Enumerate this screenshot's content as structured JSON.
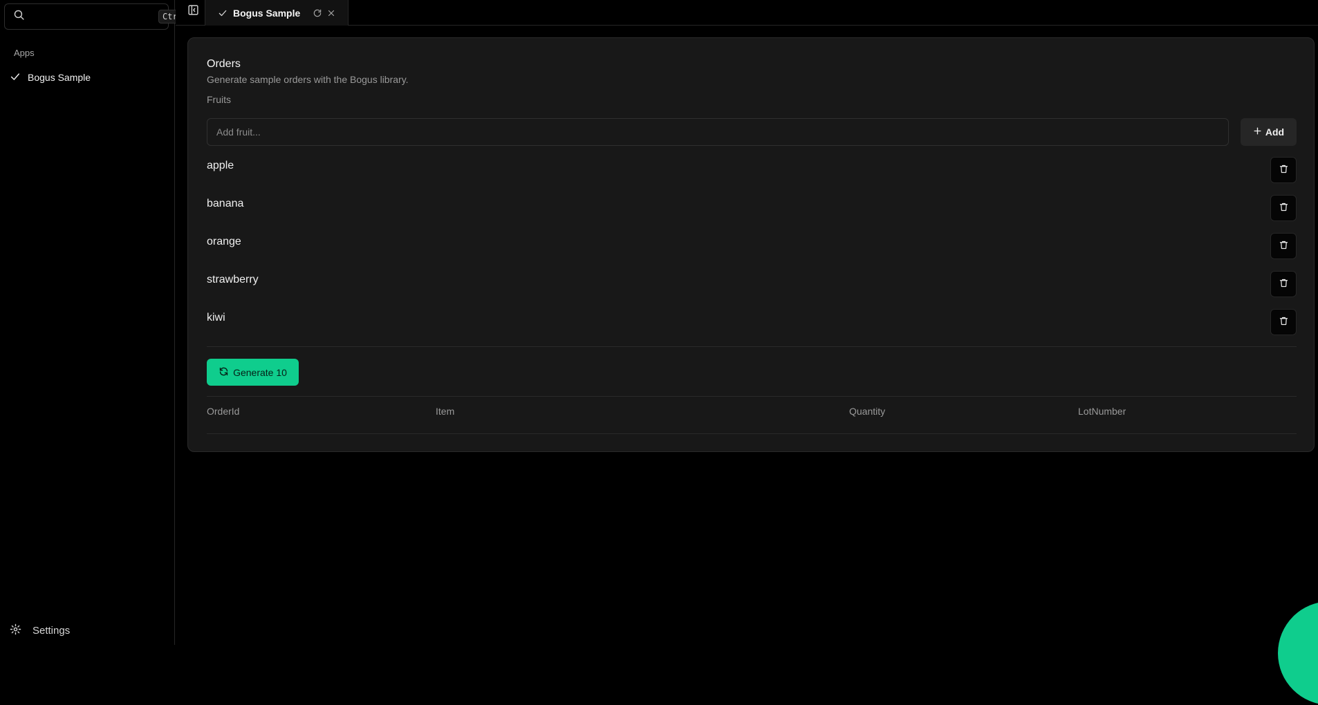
{
  "sidebar": {
    "search_placeholder": "",
    "search_shortcut": "Ctrl+K",
    "section_label": "Apps",
    "items": [
      {
        "label": "Bogus Sample",
        "icon": "check-icon"
      }
    ],
    "settings_label": "Settings"
  },
  "tabs": [
    {
      "label": "Bogus Sample",
      "icon": "check-icon"
    }
  ],
  "card": {
    "title": "Orders",
    "description": "Generate sample orders with the Bogus library.",
    "field_label": "Fruits",
    "input_placeholder": "Add fruit...",
    "add_label": "Add",
    "fruits": [
      "apple",
      "banana",
      "orange",
      "strawberry",
      "kiwi"
    ],
    "generate_label": "Generate 10",
    "table_columns": [
      "OrderId",
      "Item",
      "Quantity",
      "LotNumber"
    ]
  },
  "colors": {
    "accent": "#0fcd8d",
    "background": "#000000",
    "card": "#181818"
  }
}
